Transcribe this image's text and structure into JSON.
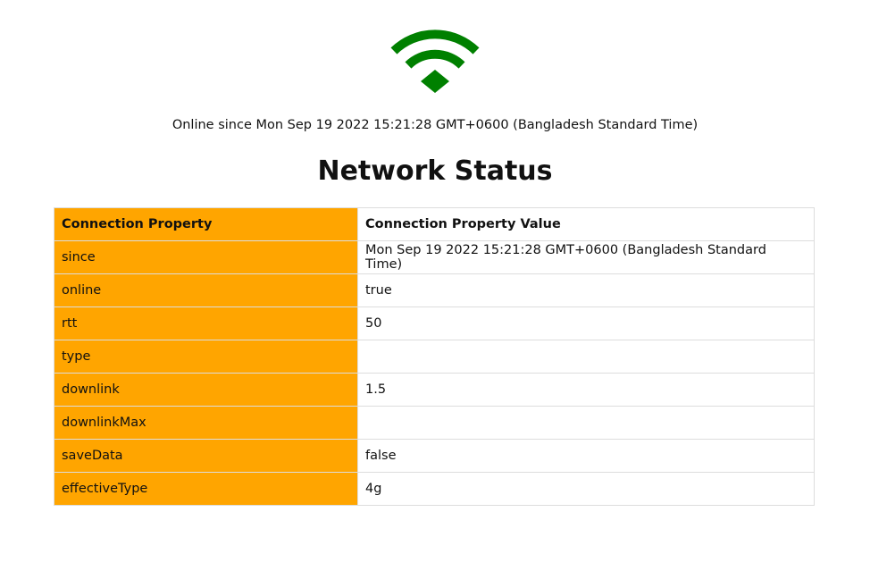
{
  "status": {
    "icon": "wifi-icon",
    "icon_color": "#008000",
    "since_text": "Online since Mon Sep 19 2022 15:21:28 GMT+0600 (Bangladesh Standard Time)"
  },
  "title": "Network Status",
  "table": {
    "header_color": "#ffa500",
    "headers": [
      "Connection Property",
      "Connection Property Value"
    ],
    "rows": [
      {
        "property": "since",
        "value": "Mon Sep 19 2022 15:21:28 GMT+0600 (Bangladesh Standard Time)"
      },
      {
        "property": "online",
        "value": "true"
      },
      {
        "property": "rtt",
        "value": "50"
      },
      {
        "property": "type",
        "value": ""
      },
      {
        "property": "downlink",
        "value": "1.5"
      },
      {
        "property": "downlinkMax",
        "value": ""
      },
      {
        "property": "saveData",
        "value": "false"
      },
      {
        "property": "effectiveType",
        "value": "4g"
      }
    ]
  }
}
